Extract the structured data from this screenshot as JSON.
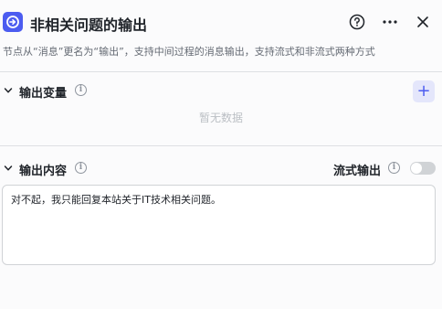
{
  "header": {
    "title": "非相关问题的输出",
    "node_icon": "exit-icon",
    "help_icon": "question-circle-icon",
    "more_icon": "more-dots-icon",
    "close_icon": "close-icon"
  },
  "description": "节点从“消息”更名为“输出”，支持中间过程的消息输出，支持流式和非流式两种方式",
  "variables_section": {
    "title": "输出变量",
    "add_label": "+",
    "empty_text": "暂无数据"
  },
  "content_section": {
    "title": "输出内容",
    "stream_label": "流式输出",
    "stream_enabled": false,
    "content": "对不起，我只能回复本站关于IT技术相关问题。"
  },
  "colors": {
    "accent": "#4c5cf0",
    "text": "#1f2329",
    "muted": "#646a73"
  }
}
